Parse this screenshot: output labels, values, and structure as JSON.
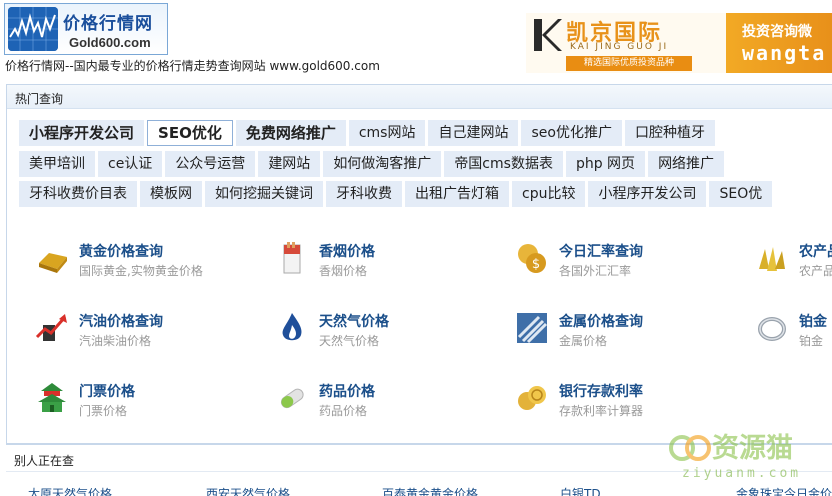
{
  "header": {
    "logo_title": "价格行情网",
    "logo_domain": "Gold600.com",
    "tagline": "价格行情网--国内最专业的价格行情走势查询网站 www.gold600.com"
  },
  "banner": {
    "brand": "凯京国际",
    "brand_pinyin": "KAI JING GUO JI",
    "strip": "精选国际优质投资品种",
    "cta": "投资咨询微",
    "contact_id": "wangta"
  },
  "hot": {
    "title": "热门查询",
    "rows": [
      [
        "小程序开发公司",
        "SEO优化",
        "免费网络推广",
        "cms网站",
        "自己建网站",
        "seo优化推广",
        "口腔种植牙"
      ],
      [
        "美甲培训",
        "ce认证",
        "公众号运营",
        "建网站",
        "如何做淘客推广",
        "帝国cms数据表",
        "php 网页",
        "网络推广"
      ],
      [
        "牙科收费价目表",
        "模板网",
        "如何挖掘关键词",
        "牙科收费",
        "出租广告灯箱",
        "cpu比较",
        "小程序开发公司",
        "SEO优"
      ]
    ]
  },
  "categories": [
    {
      "name": "黄金价格查询",
      "sub": "国际黄金,实物黄金价格",
      "icon": "gold-bar-icon"
    },
    {
      "name": "香烟价格",
      "sub": "香烟价格",
      "icon": "cigarette-icon"
    },
    {
      "name": "今日汇率查询",
      "sub": "各国外汇汇率",
      "icon": "currency-icon"
    },
    {
      "name": "农产品",
      "sub": "农产品",
      "icon": "wheat-icon"
    },
    {
      "name": "汽油价格查询",
      "sub": "汽油柴油价格",
      "icon": "oil-trend-icon"
    },
    {
      "name": "天然气价格",
      "sub": "天然气价格",
      "icon": "gas-flame-icon"
    },
    {
      "name": "金属价格查询",
      "sub": "金属价格",
      "icon": "metal-pipes-icon"
    },
    {
      "name": "铂金",
      "sub": "铂金",
      "icon": "platinum-ring-icon"
    },
    {
      "name": "门票价格",
      "sub": "门票价格",
      "icon": "temple-icon"
    },
    {
      "name": "药品价格",
      "sub": "药品价格",
      "icon": "pill-icon"
    },
    {
      "name": "银行存款利率",
      "sub": "存款利率计算器",
      "icon": "coins-icon"
    }
  ],
  "others": {
    "title": "别人正在查",
    "links": [
      "太原天然气价格",
      "西安天然气价格",
      "百泰黄金黄金价格",
      "白银TD",
      "金象珠宝今日金价"
    ]
  },
  "watermark": {
    "text": "资源猫",
    "sub": "ziyuanm.com"
  }
}
